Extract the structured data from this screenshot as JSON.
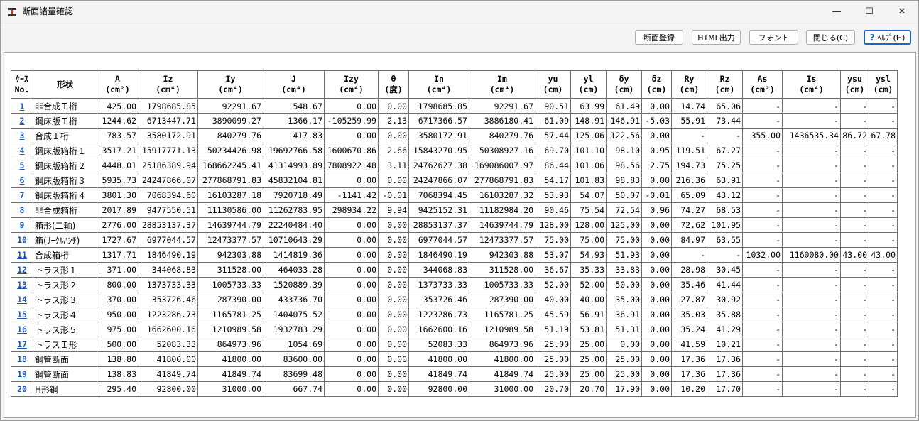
{
  "window": {
    "title": "断面諸量確認",
    "minimize_glyph": "—",
    "maximize_glyph": "☐",
    "close_glyph": "✕"
  },
  "toolbar": {
    "register_label": "断面登録",
    "html_label": "HTML出力",
    "font_label": "フォント",
    "close_label": "閉じる(C)",
    "help_label": "ﾍﾙﾌﾟ(H)"
  },
  "table": {
    "headers": [
      {
        "line1": "ｹｰｽ",
        "line2": "No."
      },
      {
        "line1": "形状",
        "line2": ""
      },
      {
        "line1": "A",
        "line2": "(cm²)"
      },
      {
        "line1": "Iz",
        "line2": "(cm⁴)"
      },
      {
        "line1": "Iy",
        "line2": "(cm⁴)"
      },
      {
        "line1": "J",
        "line2": "(cm⁴)"
      },
      {
        "line1": "Izy",
        "line2": "(cm⁴)"
      },
      {
        "line1": "θ",
        "line2": "(度)"
      },
      {
        "line1": "In",
        "line2": "(cm⁴)"
      },
      {
        "line1": "Im",
        "line2": "(cm⁴)"
      },
      {
        "line1": "yu",
        "line2": "(cm)"
      },
      {
        "line1": "yl",
        "line2": "(cm)"
      },
      {
        "line1": "δy",
        "line2": "(cm)"
      },
      {
        "line1": "δz",
        "line2": "(cm)"
      },
      {
        "line1": "Ry",
        "line2": "(cm)"
      },
      {
        "line1": "Rz",
        "line2": "(cm)"
      },
      {
        "line1": "As",
        "line2": "(cm²)"
      },
      {
        "line1": "Is",
        "line2": "(cm⁴)"
      },
      {
        "line1": "ysu",
        "line2": "(cm)"
      },
      {
        "line1": "ysl",
        "line2": "(cm)"
      }
    ],
    "rows": [
      [
        "1",
        "非合成Ｉ桁",
        "425.00",
        "1798685.85",
        "92291.67",
        "548.67",
        "0.00",
        "0.00",
        "1798685.85",
        "92291.67",
        "90.51",
        "63.99",
        "61.49",
        "0.00",
        "14.74",
        "65.06",
        "-",
        "-",
        "-",
        "-"
      ],
      [
        "2",
        "鋼床版Ｉ桁",
        "1244.62",
        "6713447.71",
        "3890099.27",
        "1366.17",
        "-105259.99",
        "2.13",
        "6717366.57",
        "3886180.41",
        "61.09",
        "148.91",
        "146.91",
        "-5.03",
        "55.91",
        "73.44",
        "-",
        "-",
        "-",
        "-"
      ],
      [
        "3",
        "合成Ｉ桁",
        "783.57",
        "3580172.91",
        "840279.76",
        "417.83",
        "0.00",
        "0.00",
        "3580172.91",
        "840279.76",
        "57.44",
        "125.06",
        "122.56",
        "0.00",
        "-",
        "-",
        "355.00",
        "1436535.34",
        "86.72",
        "67.78"
      ],
      [
        "4",
        "鋼床版箱桁１",
        "3517.21",
        "15917771.13",
        "50234426.98",
        "19692766.58",
        "1600670.86",
        "2.66",
        "15843270.95",
        "50308927.16",
        "69.70",
        "101.10",
        "98.10",
        "0.95",
        "119.51",
        "67.27",
        "-",
        "-",
        "-",
        "-"
      ],
      [
        "5",
        "鋼床版箱桁２",
        "4448.01",
        "25186389.94",
        "168662245.41",
        "41314993.89",
        "7808922.48",
        "3.11",
        "24762627.38",
        "169086007.97",
        "86.44",
        "101.06",
        "98.56",
        "2.75",
        "194.73",
        "75.25",
        "-",
        "-",
        "-",
        "-"
      ],
      [
        "6",
        "鋼床版箱桁３",
        "5935.73",
        "24247866.07",
        "277868791.83",
        "45832104.81",
        "0.00",
        "0.00",
        "24247866.07",
        "277868791.83",
        "54.17",
        "101.83",
        "98.83",
        "0.00",
        "216.36",
        "63.91",
        "-",
        "-",
        "-",
        "-"
      ],
      [
        "7",
        "鋼床版箱桁４",
        "3801.30",
        "7068394.60",
        "16103287.18",
        "7920718.49",
        "-1141.42",
        "-0.01",
        "7068394.45",
        "16103287.32",
        "53.93",
        "54.07",
        "50.07",
        "-0.01",
        "65.09",
        "43.12",
        "-",
        "-",
        "-",
        "-"
      ],
      [
        "8",
        "非合成箱桁",
        "2017.89",
        "9477550.51",
        "11130586.00",
        "11262783.95",
        "298934.22",
        "9.94",
        "9425152.31",
        "11182984.20",
        "90.46",
        "75.54",
        "72.54",
        "0.96",
        "74.27",
        "68.53",
        "-",
        "-",
        "-",
        "-"
      ],
      [
        "9",
        "箱形(二軸)",
        "2776.00",
        "28853137.37",
        "14639744.79",
        "22240484.40",
        "0.00",
        "0.00",
        "28853137.37",
        "14639744.79",
        "128.00",
        "128.00",
        "125.00",
        "0.00",
        "72.62",
        "101.95",
        "-",
        "-",
        "-",
        "-"
      ],
      [
        "10",
        "箱(ｻｰｸﾙﾊﾝﾁ)",
        "1727.67",
        "6977044.57",
        "12473377.57",
        "10710643.29",
        "0.00",
        "0.00",
        "6977044.57",
        "12473377.57",
        "75.00",
        "75.00",
        "75.00",
        "0.00",
        "84.97",
        "63.55",
        "-",
        "-",
        "-",
        "-"
      ],
      [
        "11",
        "合成箱桁",
        "1317.71",
        "1846490.19",
        "942303.88",
        "1414819.36",
        "0.00",
        "0.00",
        "1846490.19",
        "942303.88",
        "53.07",
        "54.93",
        "51.93",
        "0.00",
        "-",
        "-",
        "1032.00",
        "1160080.00",
        "43.00",
        "43.00"
      ],
      [
        "12",
        "トラス形１",
        "371.00",
        "344068.83",
        "311528.00",
        "464033.28",
        "0.00",
        "0.00",
        "344068.83",
        "311528.00",
        "36.67",
        "35.33",
        "33.83",
        "0.00",
        "28.98",
        "30.45",
        "-",
        "-",
        "-",
        "-"
      ],
      [
        "13",
        "トラス形２",
        "800.00",
        "1373733.33",
        "1005733.33",
        "1520889.39",
        "0.00",
        "0.00",
        "1373733.33",
        "1005733.33",
        "52.00",
        "52.00",
        "50.00",
        "0.00",
        "35.46",
        "41.44",
        "-",
        "-",
        "-",
        "-"
      ],
      [
        "14",
        "トラス形３",
        "370.00",
        "353726.46",
        "287390.00",
        "433736.70",
        "0.00",
        "0.00",
        "353726.46",
        "287390.00",
        "40.00",
        "40.00",
        "35.00",
        "0.00",
        "27.87",
        "30.92",
        "-",
        "-",
        "-",
        "-"
      ],
      [
        "15",
        "トラス形４",
        "950.00",
        "1223286.73",
        "1165781.25",
        "1404075.52",
        "0.00",
        "0.00",
        "1223286.73",
        "1165781.25",
        "45.59",
        "56.91",
        "36.91",
        "0.00",
        "35.03",
        "35.88",
        "-",
        "-",
        "-",
        "-"
      ],
      [
        "16",
        "トラス形５",
        "975.00",
        "1662600.16",
        "1210989.58",
        "1932783.29",
        "0.00",
        "0.00",
        "1662600.16",
        "1210989.58",
        "51.19",
        "53.81",
        "51.31",
        "0.00",
        "35.24",
        "41.29",
        "-",
        "-",
        "-",
        "-"
      ],
      [
        "17",
        "トラスＩ形",
        "500.00",
        "52083.33",
        "864973.96",
        "1054.69",
        "0.00",
        "0.00",
        "52083.33",
        "864973.96",
        "25.00",
        "25.00",
        "0.00",
        "0.00",
        "41.59",
        "10.21",
        "-",
        "-",
        "-",
        "-"
      ],
      [
        "18",
        "鋼管断面",
        "138.80",
        "41800.00",
        "41800.00",
        "83600.00",
        "0.00",
        "0.00",
        "41800.00",
        "41800.00",
        "25.00",
        "25.00",
        "25.00",
        "0.00",
        "17.36",
        "17.36",
        "-",
        "-",
        "-",
        "-"
      ],
      [
        "19",
        "鋼管断面",
        "138.83",
        "41849.74",
        "41849.74",
        "83699.48",
        "0.00",
        "0.00",
        "41849.74",
        "41849.74",
        "25.00",
        "25.00",
        "25.00",
        "0.00",
        "17.36",
        "17.36",
        "-",
        "-",
        "-",
        "-"
      ],
      [
        "20",
        "H形鋼",
        "295.40",
        "92800.00",
        "31000.00",
        "667.74",
        "0.00",
        "0.00",
        "92800.00",
        "31000.00",
        "20.70",
        "20.70",
        "17.90",
        "0.00",
        "10.20",
        "17.70",
        "-",
        "-",
        "-",
        "-"
      ]
    ]
  }
}
